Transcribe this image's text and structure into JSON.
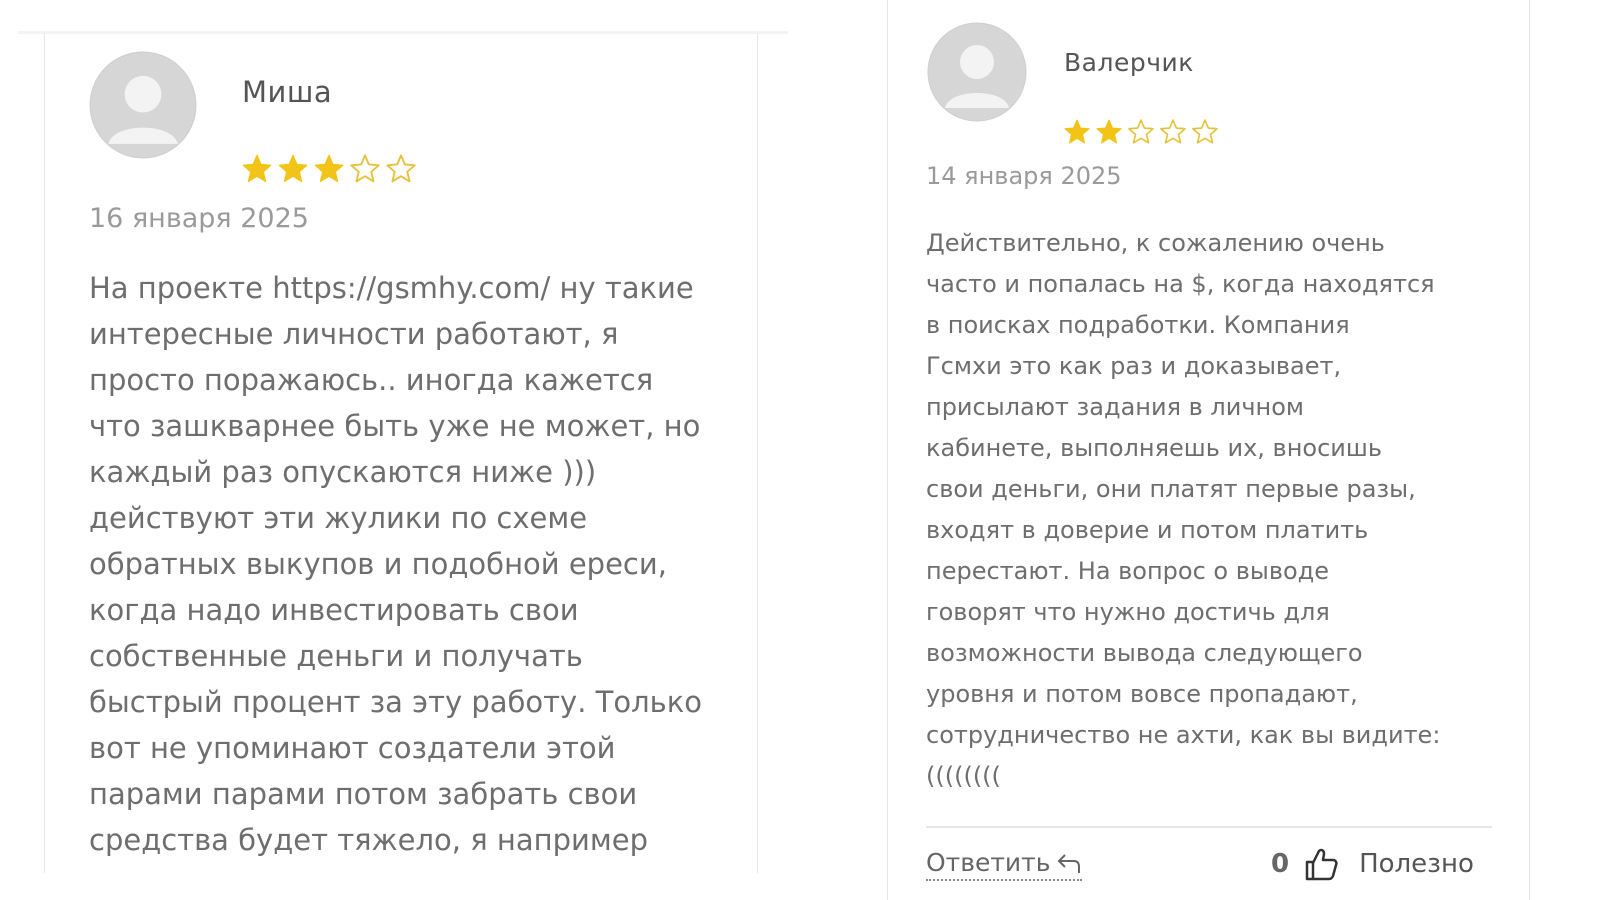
{
  "colors": {
    "star_filled": "#f2c418",
    "star_empty": "#e5c23a",
    "avatar_bg": "#d8d8d8",
    "avatar_fg": "#f2f2f2"
  },
  "reviews": [
    {
      "author": "Миша",
      "rating": 3,
      "max_rating": 5,
      "date": "16 января 2025",
      "text": "На проекте https://gsmhy.com/ ну такие\nинтересные личности работают, я\nпросто поражаюсь.. иногда кажется\nчто зашкварнее быть уже не может, но\nкаждый раз опускаются ниже )))\nдействуют эти жулики по схеме\nобратных выкупов и подобной ереси,\nкогда надо инвестировать свои\nсобственные деньги и получать\nбыстрый процент за эту работу. Только\nвот не упоминают создатели этой\nпарами парами потом забрать свои\nсредства будет тяжело, я например"
    },
    {
      "author": "Валерчик",
      "rating": 2,
      "max_rating": 5,
      "date": "14 января 2025",
      "text": "Действительно, к сожалению очень\nчасто и попалась на $, когда находятся\nв поисках подработки. Компания\nГсмхи это как раз и доказывает,\nприсылают задания в личном\nкабинете, выполняешь их, вносишь\nсвои деньги, они платят первые разы,\nвходят в доверие и потом платить\nперестают. На вопрос о выводе\nговорят что нужно достичь для\nвозможности вывода следующего\nуровня и потом вовсе пропадают,\nсотрудничество не ахти, как вы видите:\n((((((((",
      "reply_label": "Ответить",
      "reply_icon": "reply-arrow-icon",
      "helpful_count": "0",
      "helpful_icon": "thumbs-up-icon",
      "helpful_label": "Полезно"
    }
  ]
}
